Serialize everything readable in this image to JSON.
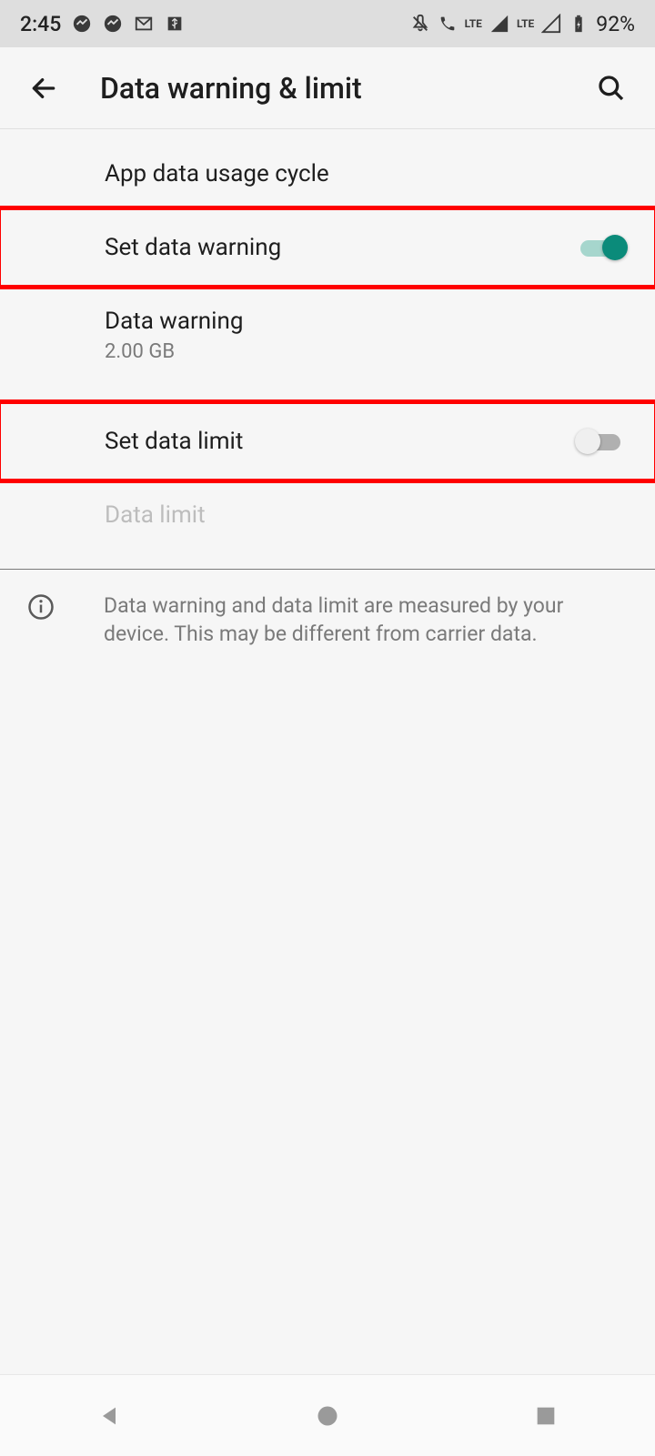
{
  "status": {
    "time": "2:45",
    "battery": "92%"
  },
  "header": {
    "title": "Data warning & limit"
  },
  "rows": {
    "cycle": {
      "label": "App data usage cycle"
    },
    "set_warning": {
      "label": "Set data warning"
    },
    "data_warning": {
      "label": "Data warning",
      "value": "2.00 GB"
    },
    "set_limit": {
      "label": "Set data limit"
    },
    "data_limit": {
      "label": "Data limit"
    },
    "info": "Data warning and data limit are measured by your device. This may be different from carrier data."
  }
}
